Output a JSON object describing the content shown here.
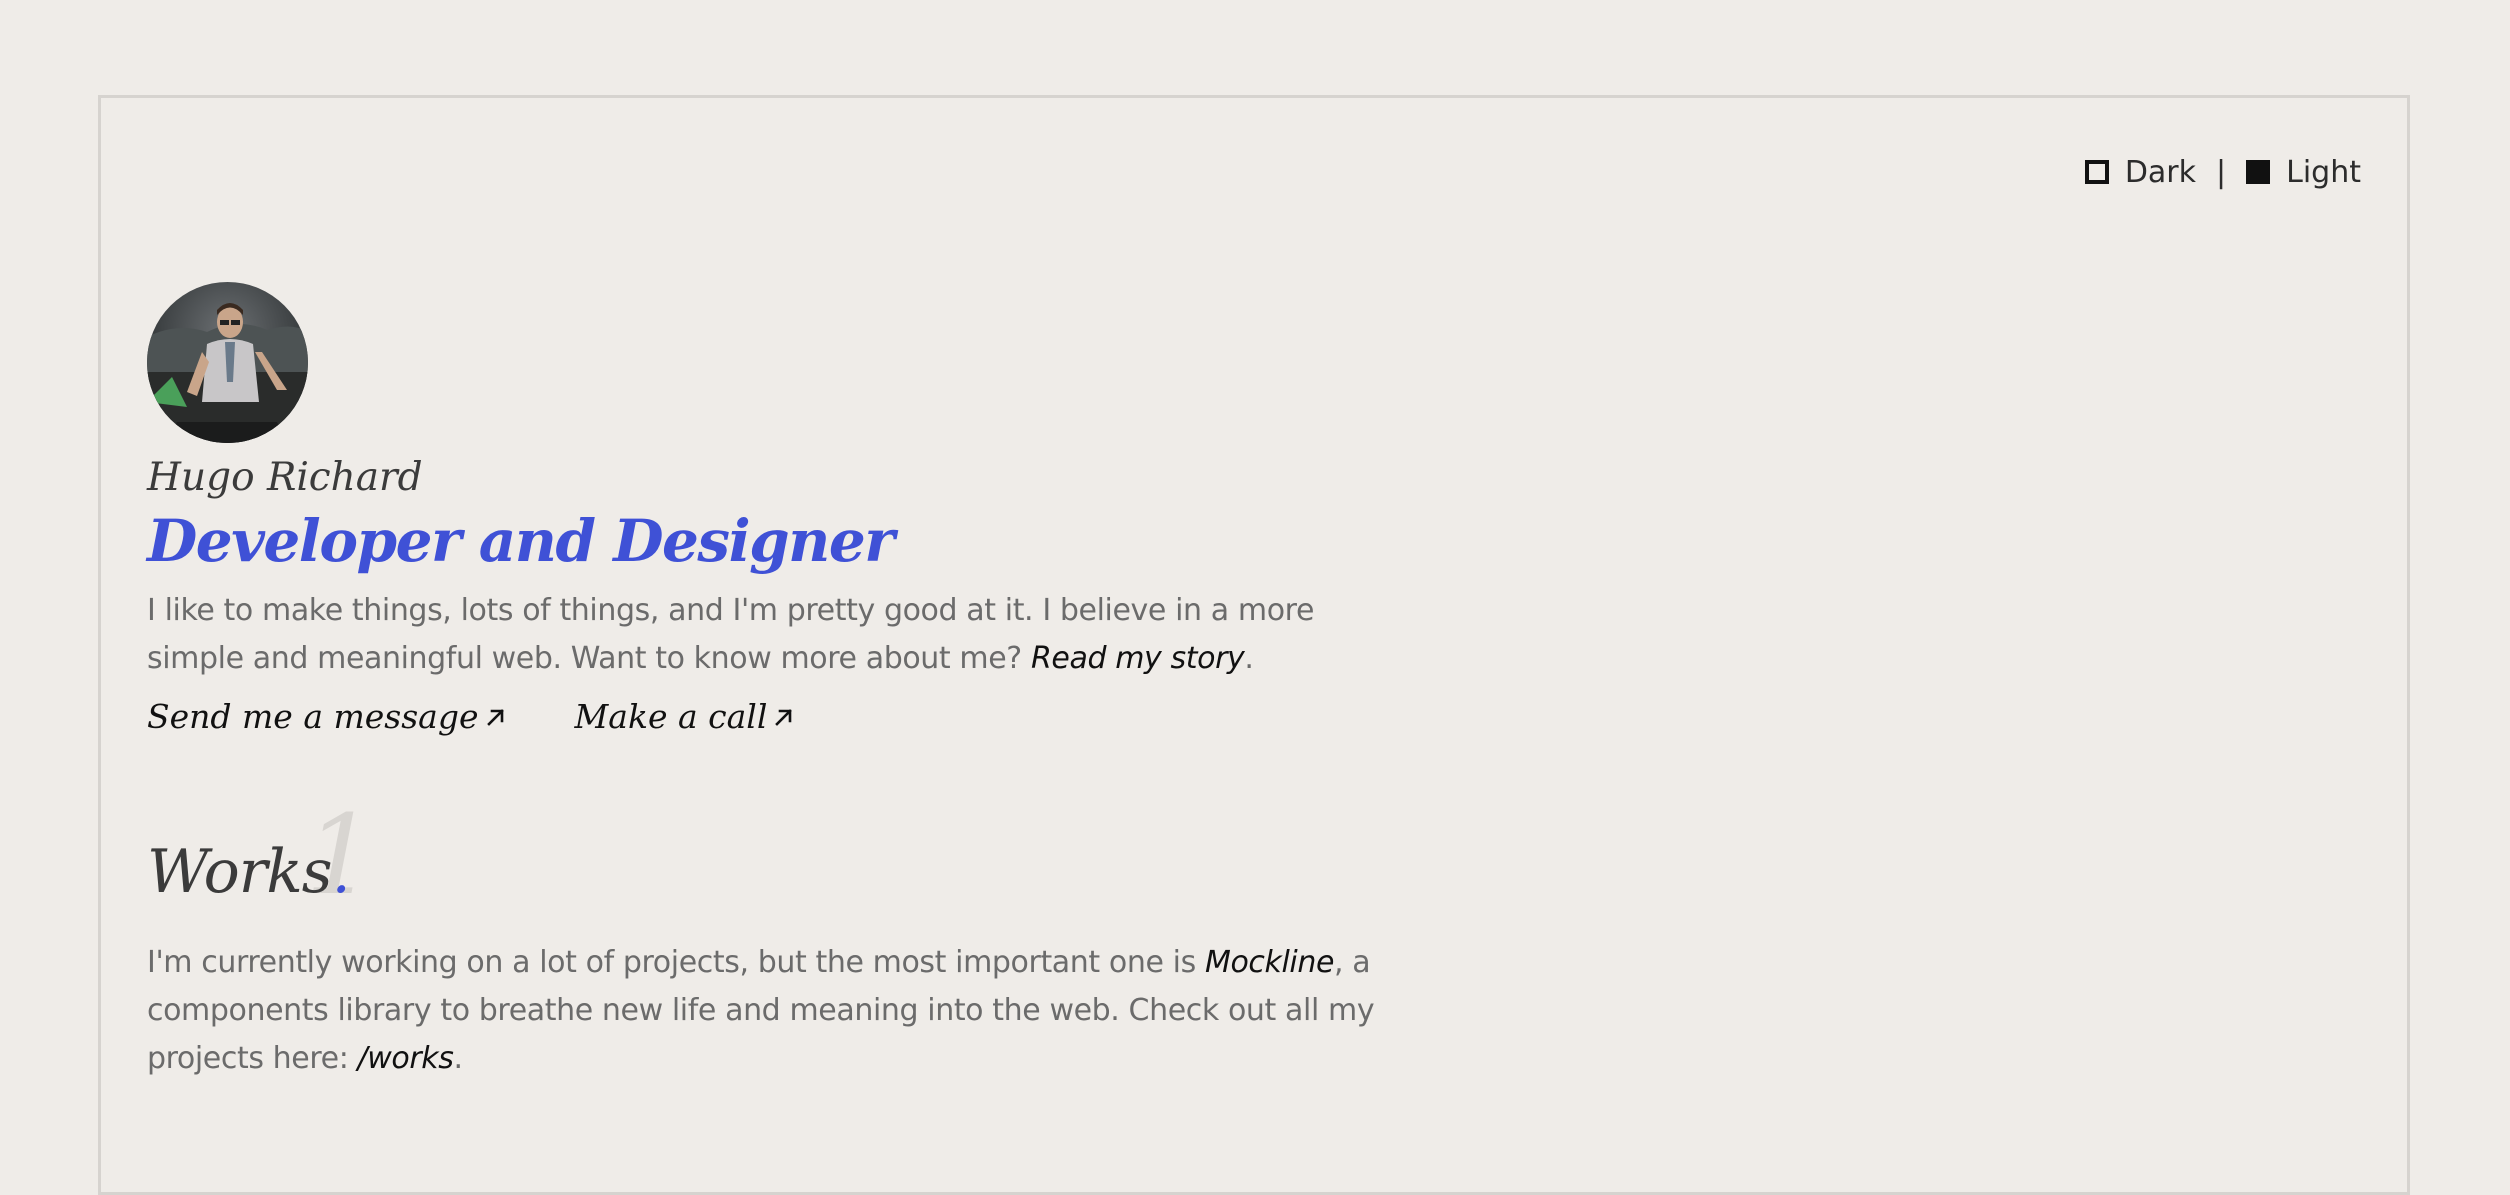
{
  "theme_toggle": {
    "dark_label": "Dark",
    "separator": "|",
    "light_label": "Light"
  },
  "profile": {
    "name": "Hugo Richard",
    "role": "Developer and Designer"
  },
  "intro": {
    "text_before": "I like to make things, lots of things, and I'm pretty good at it. I believe in a more simple and meaningful web. Want to know more about me? ",
    "story_link": "Read my story",
    "text_after": "."
  },
  "contact": {
    "message_label": "Send me a message",
    "call_label": "Make a call",
    "arrow_icon": "arrow-up-right-icon"
  },
  "works": {
    "title": "Works",
    "title_dot": ".",
    "number": "1",
    "text_before": "I'm currently working on a lot of projects, but the most important one is ",
    "mockline_link": "Mockline",
    "text_middle": ", a components library to breathe new life and meaning into the web. Check out all my projects here: ",
    "works_link": "/works",
    "text_after": "."
  },
  "colors": {
    "background": "#efece8",
    "accent": "#3f51d6",
    "text": "#6b6b6b",
    "heading": "#3b3b3b"
  }
}
